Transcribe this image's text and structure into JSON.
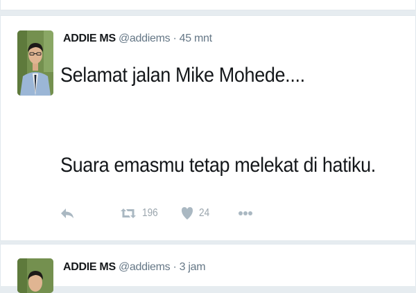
{
  "tweets": [
    {
      "fullname": "ADDIE MS",
      "handle": "@addiems",
      "separator": "·",
      "time": "45 mnt",
      "text_lines": [
        "Selamat jalan Mike Mohede....",
        "Suara emasmu tetap melekat di hatiku."
      ],
      "retweets": "196",
      "likes": "24",
      "icons": [
        "reply-icon",
        "retweet-icon",
        "heart-icon",
        "more-icon"
      ]
    },
    {
      "fullname": "ADDIE MS",
      "handle": "@addiems",
      "separator": "·",
      "time": "3 jam"
    }
  ],
  "colors": {
    "background": "#e6ecf0",
    "card": "#ffffff",
    "icon": "#aab8c2",
    "muted": "#657786",
    "text": "#14171a"
  }
}
